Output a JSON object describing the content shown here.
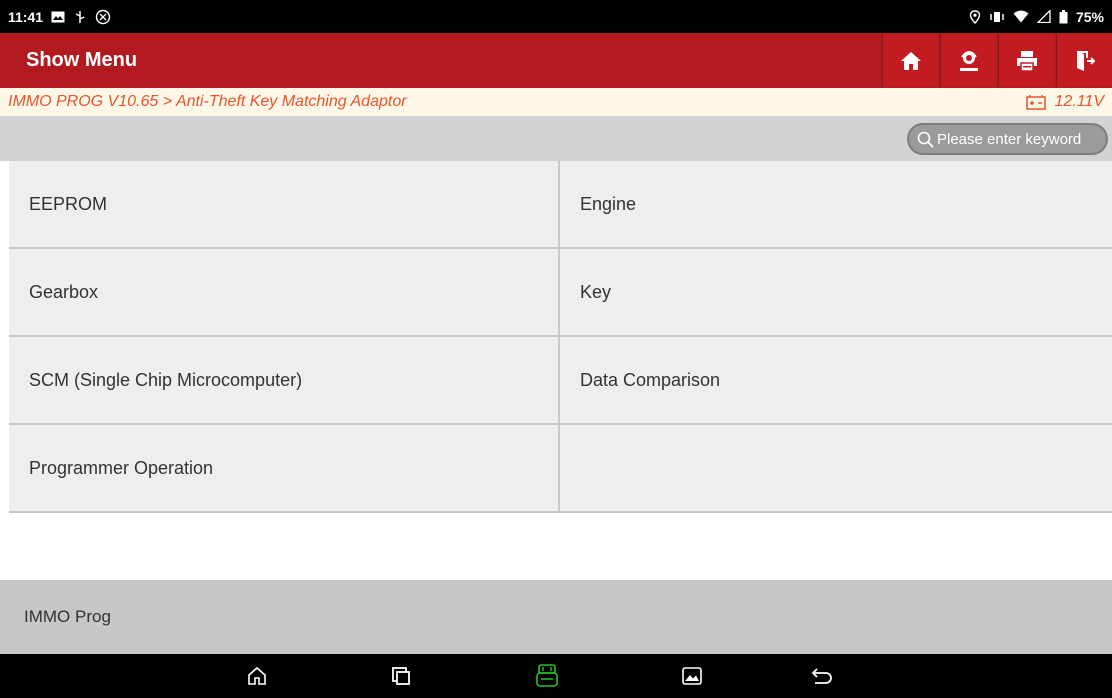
{
  "status_bar": {
    "time": "11:41",
    "battery": "75%",
    "left_icons": [
      "image-icon",
      "usb-icon",
      "settings-icon"
    ],
    "right_icons": [
      "location-icon",
      "vibrate-icon",
      "wifi-icon",
      "signal-icon",
      "battery-icon"
    ]
  },
  "header": {
    "title": "Show Menu",
    "buttons": [
      "home-icon",
      "support-icon",
      "print-icon",
      "exit-icon"
    ],
    "background": "#b31a1f"
  },
  "breadcrumb": {
    "path": "IMMO PROG V10.65 > Anti-Theft Key Matching Adaptor",
    "voltage": "12.11V",
    "accent": "#e8542b"
  },
  "search": {
    "placeholder": "Please enter keyword"
  },
  "menu": {
    "items": [
      {
        "label": "EEPROM"
      },
      {
        "label": "Engine"
      },
      {
        "label": "Gearbox"
      },
      {
        "label": "Key"
      },
      {
        "label": "SCM (Single Chip Microcomputer)"
      },
      {
        "label": "Data Comparison"
      },
      {
        "label": "Programmer Operation"
      },
      {
        "label": ""
      }
    ]
  },
  "footer": {
    "title": "IMMO Prog"
  },
  "navbar": {
    "buttons": [
      "home-icon",
      "recent-apps-icon",
      "vci-icon",
      "gallery-icon",
      "back-icon"
    ],
    "vci_color": "#22c32e"
  }
}
